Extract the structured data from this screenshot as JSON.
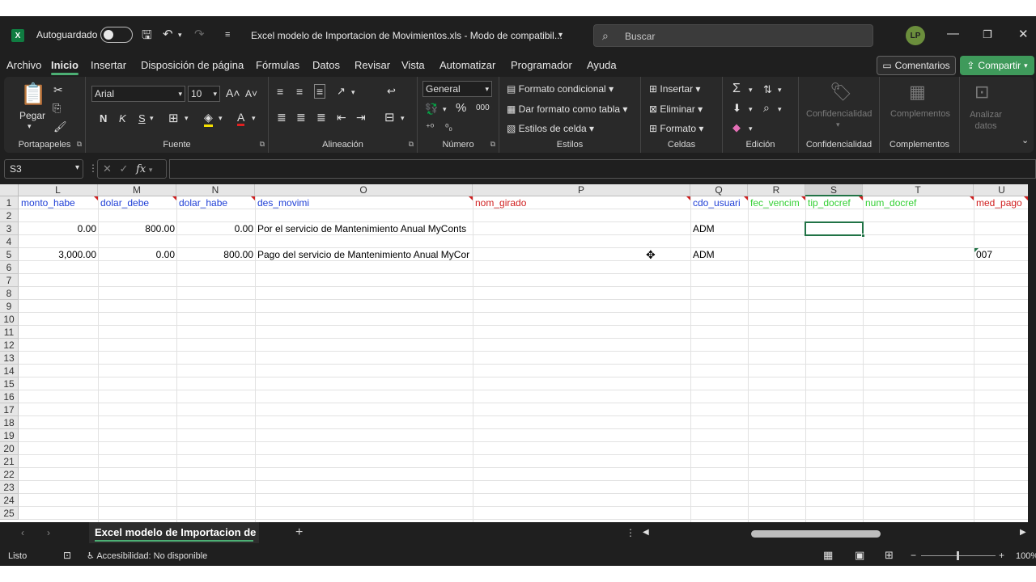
{
  "titlebar": {
    "app_icon": "X",
    "autosave_label": "Autoguardado",
    "title": "Excel modelo de Importacion de Movimientos.xls  -  Modo de compatibil...",
    "search_placeholder": "Buscar",
    "avatar_initials": "LP"
  },
  "menu": {
    "items": [
      "Archivo",
      "Inicio",
      "Insertar",
      "Disposición de página",
      "Fórmulas",
      "Datos",
      "Revisar",
      "Vista",
      "Automatizar",
      "Programador",
      "Ayuda"
    ],
    "active": "Inicio",
    "comments": "Comentarios",
    "share": "Compartir"
  },
  "ribbon": {
    "clipboard": {
      "label": "Portapapeles",
      "paste": "Pegar"
    },
    "font": {
      "label": "Fuente",
      "name": "Arial",
      "size": "10",
      "bold": "N",
      "italic": "K",
      "underline": "S"
    },
    "alignment": {
      "label": "Alineación"
    },
    "number": {
      "label": "Número",
      "format": "General",
      "percent": "%",
      "thousands": "000"
    },
    "styles": {
      "label": "Estilos",
      "conditional": "Formato condicional",
      "table": "Dar formato como tabla",
      "cell_styles": "Estilos de celda"
    },
    "cells": {
      "label": "Celdas",
      "insert": "Insertar",
      "delete": "Eliminar",
      "format": "Formato"
    },
    "editing": {
      "label": "Edición"
    },
    "sensitivity": {
      "label": "Confidencialidad",
      "button": "Confidencialidad"
    },
    "addins": {
      "label": "Complementos",
      "button": "Complementos"
    },
    "analyze": {
      "button": "Analizar datos"
    }
  },
  "formula_bar": {
    "name_box": "S3",
    "fx": "fx",
    "value": ""
  },
  "columns": [
    {
      "letter": "L",
      "header": "monto_habe",
      "header_color": "blue"
    },
    {
      "letter": "M",
      "header": "dolar_debe",
      "header_color": "blue"
    },
    {
      "letter": "N",
      "header": "dolar_habe",
      "header_color": "blue"
    },
    {
      "letter": "O",
      "header": "des_movimi",
      "header_color": "blue"
    },
    {
      "letter": "P",
      "header": "nom_girado",
      "header_color": "red"
    },
    {
      "letter": "Q",
      "header": "cdo_usuari",
      "header_color": "blue"
    },
    {
      "letter": "R",
      "header": "fec_vencim",
      "header_color": "green"
    },
    {
      "letter": "S",
      "header": "tip_docref",
      "header_color": "green"
    },
    {
      "letter": "T",
      "header": "num_docref",
      "header_color": "green"
    },
    {
      "letter": "U",
      "header": "med_pago",
      "header_color": "red"
    }
  ],
  "rows": [
    "1",
    "2",
    "3",
    "4",
    "5",
    "6",
    "7",
    "8",
    "9",
    "10",
    "11",
    "12",
    "13",
    "14",
    "15",
    "16",
    "17",
    "18",
    "19",
    "20",
    "21",
    "22",
    "23",
    "24",
    "25"
  ],
  "data": {
    "r3": {
      "L": "0.00",
      "M": "800.00",
      "N": "0.00",
      "O": "Por el servicio de Mantenimiento Anual MyConts",
      "Q": "ADM"
    },
    "r5": {
      "L": "3,000.00",
      "M": "0.00",
      "N": "800.00",
      "O": "Pago del servicio de Mantenimiento Anual MyCor",
      "Q": "ADM",
      "U": "007"
    }
  },
  "selected_cell": "S3",
  "sheet_tab": "Excel modelo de Importacion de",
  "status": {
    "ready": "Listo",
    "accessibility": "Accesibilidad: No disponible",
    "zoom": "100%"
  },
  "colors": {
    "excel_green": "#217346",
    "accent_green": "#4caf74",
    "header_blue": "#1f3fd6",
    "header_red": "#d02020",
    "header_green": "#34d034"
  }
}
